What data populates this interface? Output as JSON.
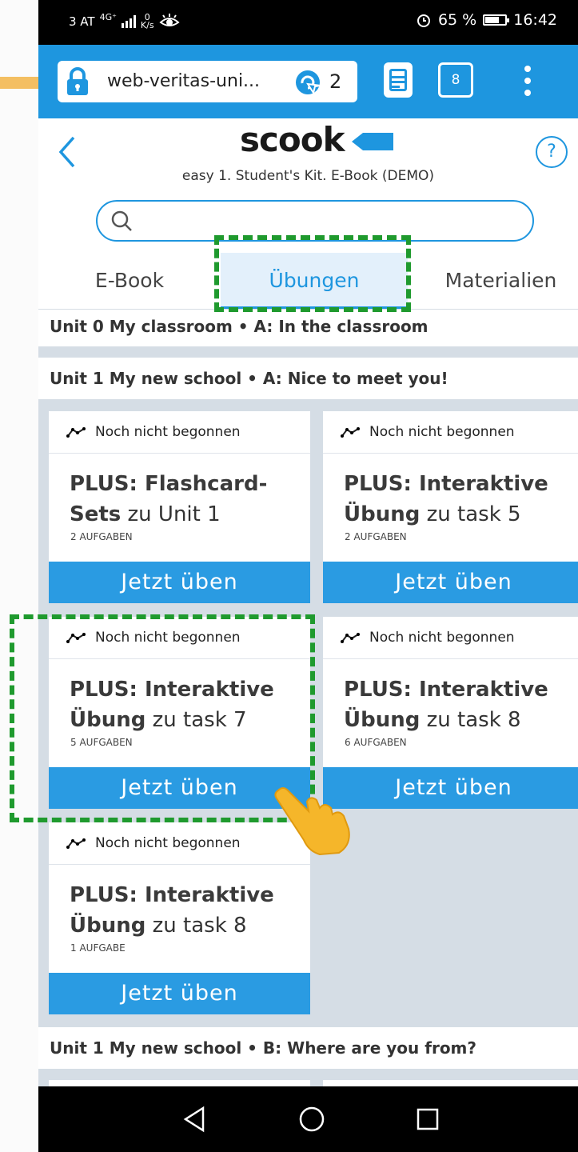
{
  "status_bar": {
    "carrier": "3 AT",
    "network": "4G⁺",
    "speed_value": "0",
    "speed_unit": "K/s",
    "battery": "65 %",
    "time": "16:42",
    "battery_level": 0.65
  },
  "browser": {
    "url": "web-veritas-uni...",
    "reload_count": "2",
    "tab_count": "8"
  },
  "header": {
    "logo": "scook",
    "subtitle": "easy 1. Student's Kit. E-Book (DEMO)",
    "help": "?"
  },
  "search": {
    "placeholder": ""
  },
  "tabs": [
    {
      "label": "E-Book"
    },
    {
      "label": "Übungen"
    },
    {
      "label": "Materialien"
    }
  ],
  "sections": [
    {
      "title": "Unit 0 My classroom • A: In the classroom"
    },
    {
      "title": "Unit 1 My new school • A: Nice to meet you!"
    },
    {
      "title": "Unit 1 My new school • B: Where are you from?"
    }
  ],
  "cards": [
    {
      "status": "Noch nicht begonnen",
      "title_bold": "PLUS: Flashcard-Sets",
      "title_rest": "zu Unit 1",
      "count": "2 AUFGABEN",
      "cta": "Jetzt üben"
    },
    {
      "status": "Noch nicht begonnen",
      "title_bold": "PLUS: Interaktive Übung",
      "title_rest": "zu task 5",
      "count": "2 AUFGABEN",
      "cta": "Jetzt üben"
    },
    {
      "status": "Noch nicht begonnen",
      "title_bold": "PLUS: Interaktive Übung",
      "title_rest": "zu task 7",
      "count": "5 AUFGABEN",
      "cta": "Jetzt üben"
    },
    {
      "status": "Noch nicht begonnen",
      "title_bold": "PLUS: Interaktive Übung",
      "title_rest": "zu task 8",
      "count": "6 AUFGABEN",
      "cta": "Jetzt üben"
    },
    {
      "status": "Noch nicht begonnen",
      "title_bold": "PLUS: Interaktive Übung",
      "title_rest": "zu task 8",
      "count": "1 AUFGABE",
      "cta": "Jetzt üben"
    }
  ],
  "colors": {
    "accent": "#1e96df",
    "button": "#2a9be2",
    "highlight_dash": "#1f9a2e",
    "hand": "#f5b62a"
  },
  "icons": {
    "lock": "lock-icon",
    "reload": "reload-icon",
    "reader": "reader-mode-icon",
    "menu": "more-vert-icon",
    "back": "chevron-left-icon",
    "help": "help-icon",
    "search": "search-icon",
    "progress": "progress-line-icon",
    "hand": "pointing-hand-icon"
  }
}
